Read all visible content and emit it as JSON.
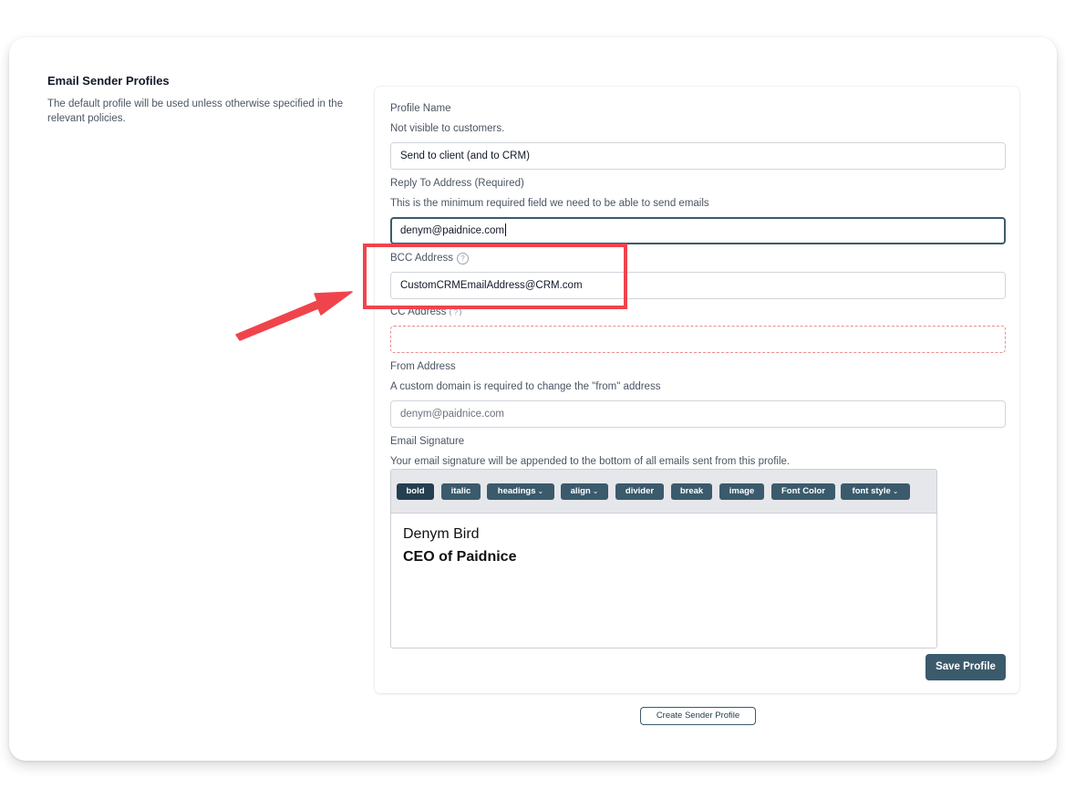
{
  "section": {
    "title": "Email Sender Profiles",
    "description": "The default profile will be used unless otherwise specified in the relevant policies."
  },
  "form": {
    "profile_name": {
      "label": "Profile Name",
      "help": "Not visible to customers.",
      "value": "Send to client (and to CRM)"
    },
    "reply_to": {
      "label": "Reply To Address (Required)",
      "help": "This is the minimum required field we need to be able to send emails",
      "value": "denym@paidnice.com"
    },
    "bcc": {
      "label": "BCC Address",
      "info_icon": "?",
      "value": "CustomCRMEmailAddress@CRM.com"
    },
    "cc": {
      "label": "CC Address",
      "info_icon": "?",
      "value": ""
    },
    "from": {
      "label": "From Address",
      "help": "A custom domain is required to change the \"from\" address",
      "placeholder": "denym@paidnice.com"
    },
    "signature": {
      "label": "Email Signature",
      "help": "Your email signature will be appended to the bottom of all emails sent from this profile.",
      "toolbar": {
        "bold": "bold",
        "italic": "italic",
        "headings": "headings",
        "align": "align",
        "divider": "divider",
        "break": "break",
        "image": "image",
        "font_color": "Font Color",
        "font_style": "font style"
      },
      "content": {
        "name": "Denym Bird",
        "title": "CEO of Paidnice"
      }
    }
  },
  "actions": {
    "save": "Save Profile",
    "create": "Create Sender Profile"
  },
  "annotation": {
    "highlight_color": "#f0444d"
  }
}
